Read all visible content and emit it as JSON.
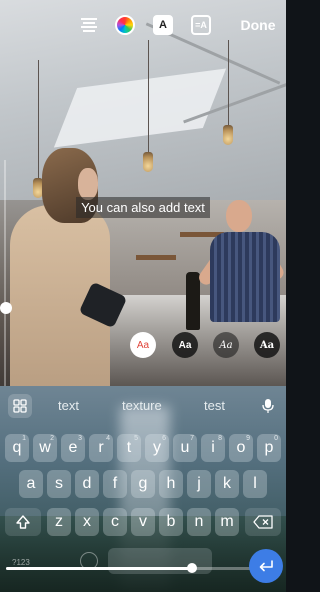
{
  "toolbar": {
    "done_label": "Done",
    "align_icon": "align-center-icon",
    "color_icon": "color-wheel-icon",
    "text_effect_icon": "text-effect-icon",
    "text_effect_glyph": "A",
    "animate_icon": "text-animate-icon",
    "animate_glyph": "=A"
  },
  "caption": {
    "text": "You can also add text"
  },
  "font_styles": [
    {
      "label": "Aa",
      "selected": true
    },
    {
      "label": "Aa",
      "selected": false
    },
    {
      "label": "Aa",
      "selected": false
    },
    {
      "label": "Aa",
      "selected": false
    }
  ],
  "suggestions": [
    "text",
    "texture",
    "test"
  ],
  "keyboard": {
    "row1": [
      {
        "key": "q",
        "num": "1"
      },
      {
        "key": "w",
        "num": "2"
      },
      {
        "key": "e",
        "num": "3"
      },
      {
        "key": "r",
        "num": "4"
      },
      {
        "key": "t",
        "num": "5"
      },
      {
        "key": "y",
        "num": "6"
      },
      {
        "key": "u",
        "num": "7"
      },
      {
        "key": "i",
        "num": "8"
      },
      {
        "key": "o",
        "num": "9"
      },
      {
        "key": "p",
        "num": "0"
      }
    ],
    "row2": [
      "a",
      "s",
      "d",
      "f",
      "g",
      "h",
      "j",
      "k",
      "l"
    ],
    "row3": [
      "z",
      "x",
      "c",
      "v",
      "b",
      "n",
      "m"
    ],
    "shift_icon": "shift-icon",
    "backspace_icon": "backspace-icon",
    "enter_icon": "enter-icon",
    "mic_icon": "microphone-icon",
    "grid_icon": "apps-grid-icon",
    "bottom_left_label": "?123"
  },
  "progress": {
    "fraction": 0.68
  },
  "colors": {
    "accent_blue": "#3d7de6",
    "selected_font_red": "#e0443a"
  }
}
